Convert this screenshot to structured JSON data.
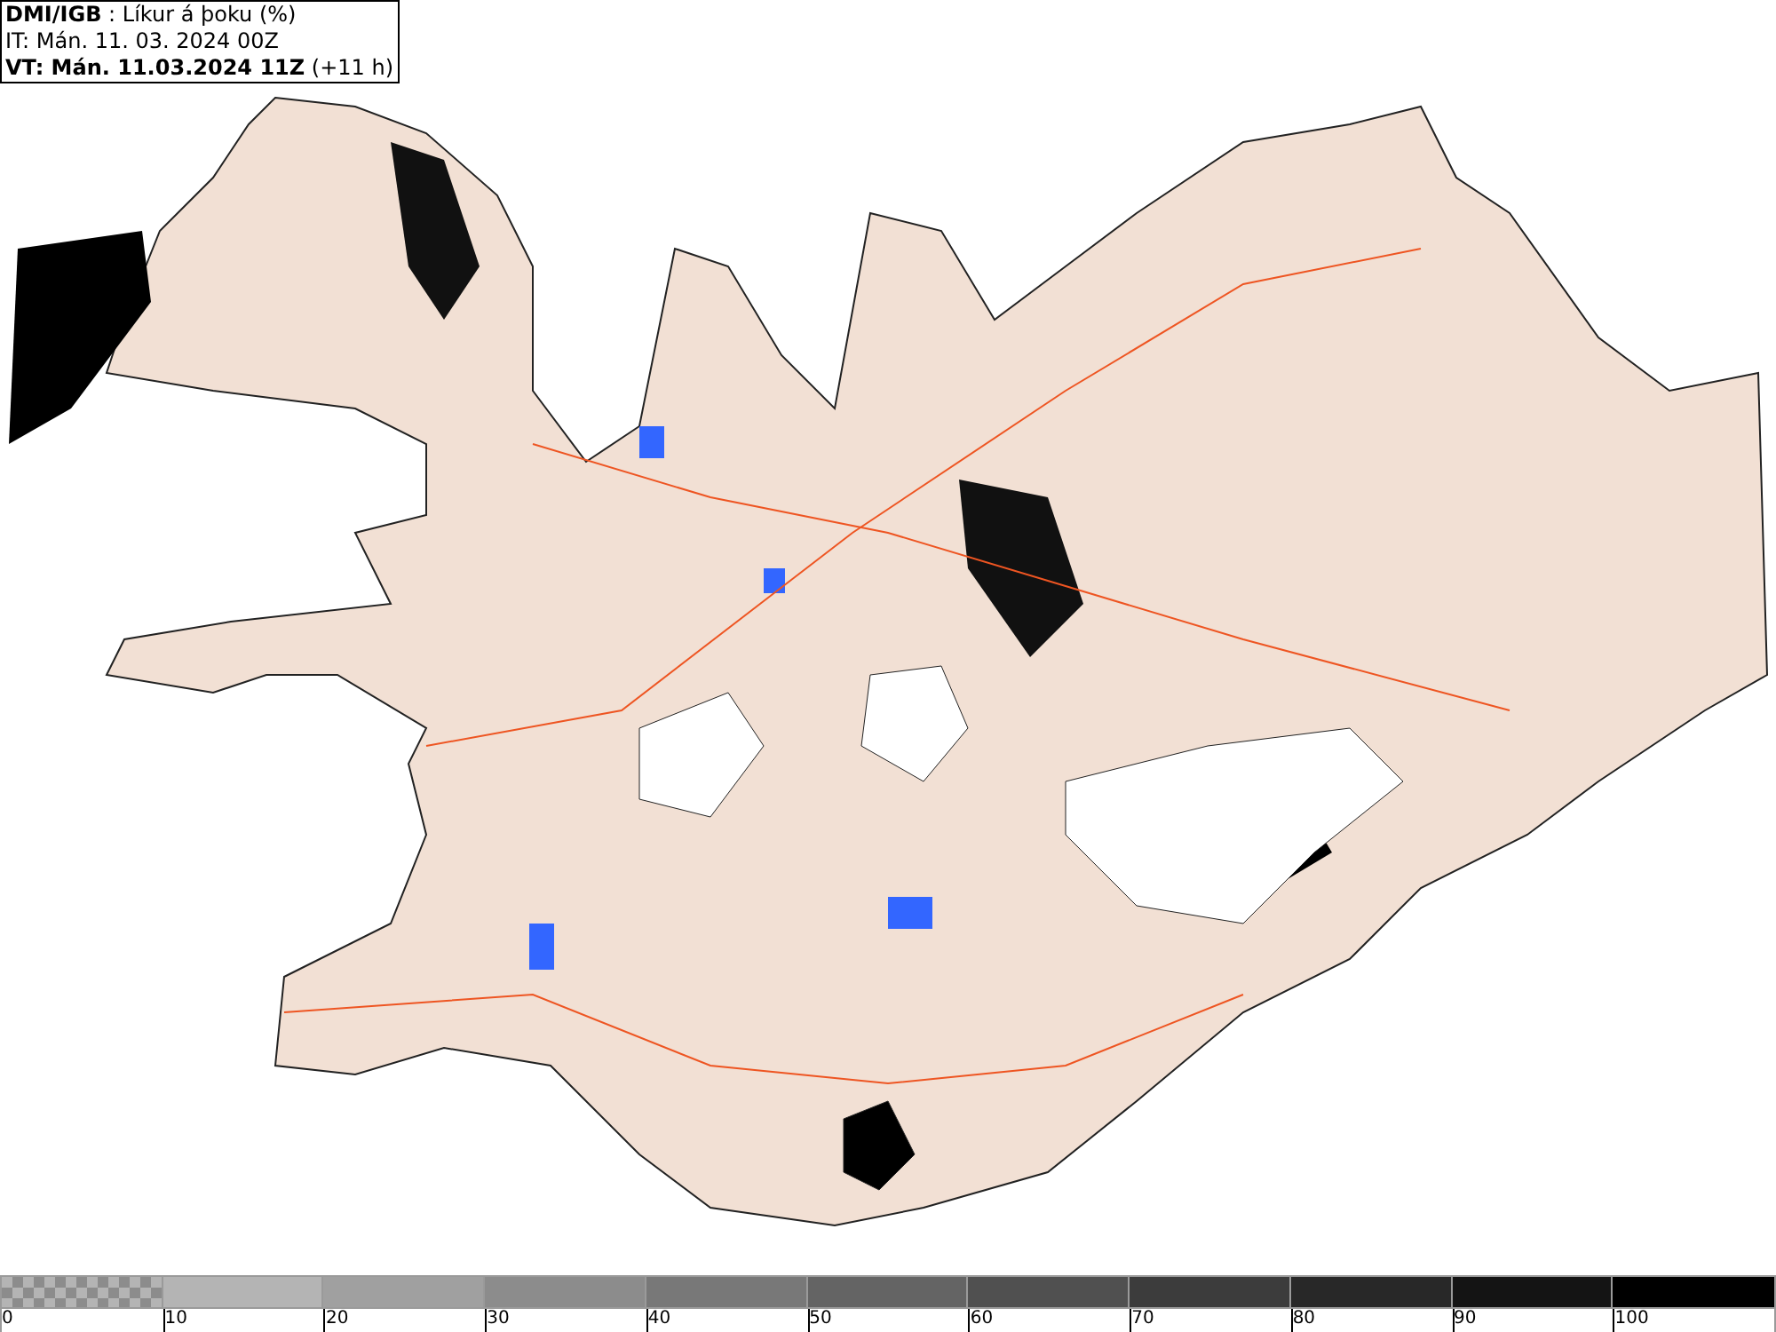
{
  "title_box": {
    "lines": [
      "**DMI/IGB** : Líkur á þoku (%)",
      "IT: Mán. 11. 03. 2024 00Z",
      "**VT: Mán. 11.03.2024 11Z** (+11 h)"
    ]
  },
  "legend": {
    "segments": [
      {
        "kind": "checker",
        "color": "#8c8c8c"
      },
      {
        "kind": "solid",
        "color": "#b4b4b4"
      },
      {
        "kind": "solid",
        "color": "#a0a0a0"
      },
      {
        "kind": "solid",
        "color": "#8c8c8c"
      },
      {
        "kind": "solid",
        "color": "#787878"
      },
      {
        "kind": "solid",
        "color": "#646464"
      },
      {
        "kind": "solid",
        "color": "#505050"
      },
      {
        "kind": "solid",
        "color": "#3c3c3c"
      },
      {
        "kind": "solid",
        "color": "#282828"
      },
      {
        "kind": "solid",
        "color": "#141414"
      },
      {
        "kind": "solid",
        "color": "#000000"
      }
    ],
    "labels": [
      "0",
      "10",
      "20",
      "30",
      "40",
      "50",
      "60",
      "70",
      "80",
      "90",
      "100"
    ]
  }
}
